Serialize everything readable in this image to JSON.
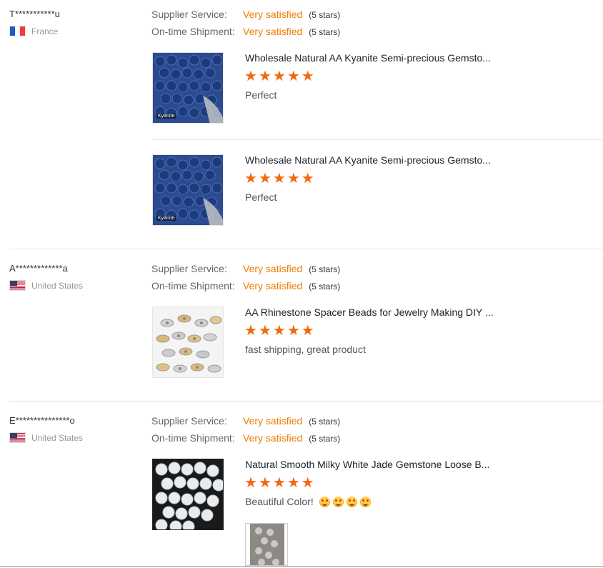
{
  "reviews": [
    {
      "user": "T***********u",
      "country": "France",
      "flag": "flag-france-icon",
      "supplier_service": {
        "label": "Supplier Service:",
        "value": "Very satisfied",
        "stars": "(5 stars)"
      },
      "shipment": {
        "label": "On-time Shipment:",
        "value": "Very satisfied",
        "stars": "(5 stars)"
      },
      "products": [
        {
          "title": "Wholesale Natural AA Kyanite Semi-precious Gemsto...",
          "rating": 5,
          "comment": "Perfect",
          "image_tag": "Kyanite"
        },
        {
          "title": "Wholesale Natural AA Kyanite Semi-precious Gemsto...",
          "rating": 5,
          "comment": "Perfect",
          "image_tag": "Kyanite"
        }
      ]
    },
    {
      "user": "A*************a",
      "country": "United States",
      "flag": "flag-usa-icon",
      "supplier_service": {
        "label": "Supplier Service:",
        "value": "Very satisfied",
        "stars": "(5 stars)"
      },
      "shipment": {
        "label": "On-time Shipment:",
        "value": "Very satisfied",
        "stars": "(5 stars)"
      },
      "products": [
        {
          "title": "AA Rhinestone Spacer Beads for Jewelry Making DIY ...",
          "rating": 5,
          "comment": "fast shipping, great product"
        }
      ]
    },
    {
      "user": "E***************o",
      "country": "United States",
      "flag": "flag-usa-icon",
      "supplier_service": {
        "label": "Supplier Service:",
        "value": "Very satisfied",
        "stars": "(5 stars)"
      },
      "shipment": {
        "label": "On-time Shipment:",
        "value": "Very satisfied",
        "stars": "(5 stars)"
      },
      "products": [
        {
          "title": "Natural Smooth Milky White Jade Gemstone Loose B...",
          "rating": 5,
          "comment": "Beautiful Color!",
          "emojis": [
            "smiling-heart-eyes-icon",
            "smiling-heart-eyes-icon",
            "smiling-heart-eyes-icon",
            "smiling-heart-eyes-icon"
          ]
        }
      ]
    }
  ],
  "colors": {
    "accent": "#f07c00",
    "star": "#f06a12",
    "divider": "#e5e5e5"
  }
}
